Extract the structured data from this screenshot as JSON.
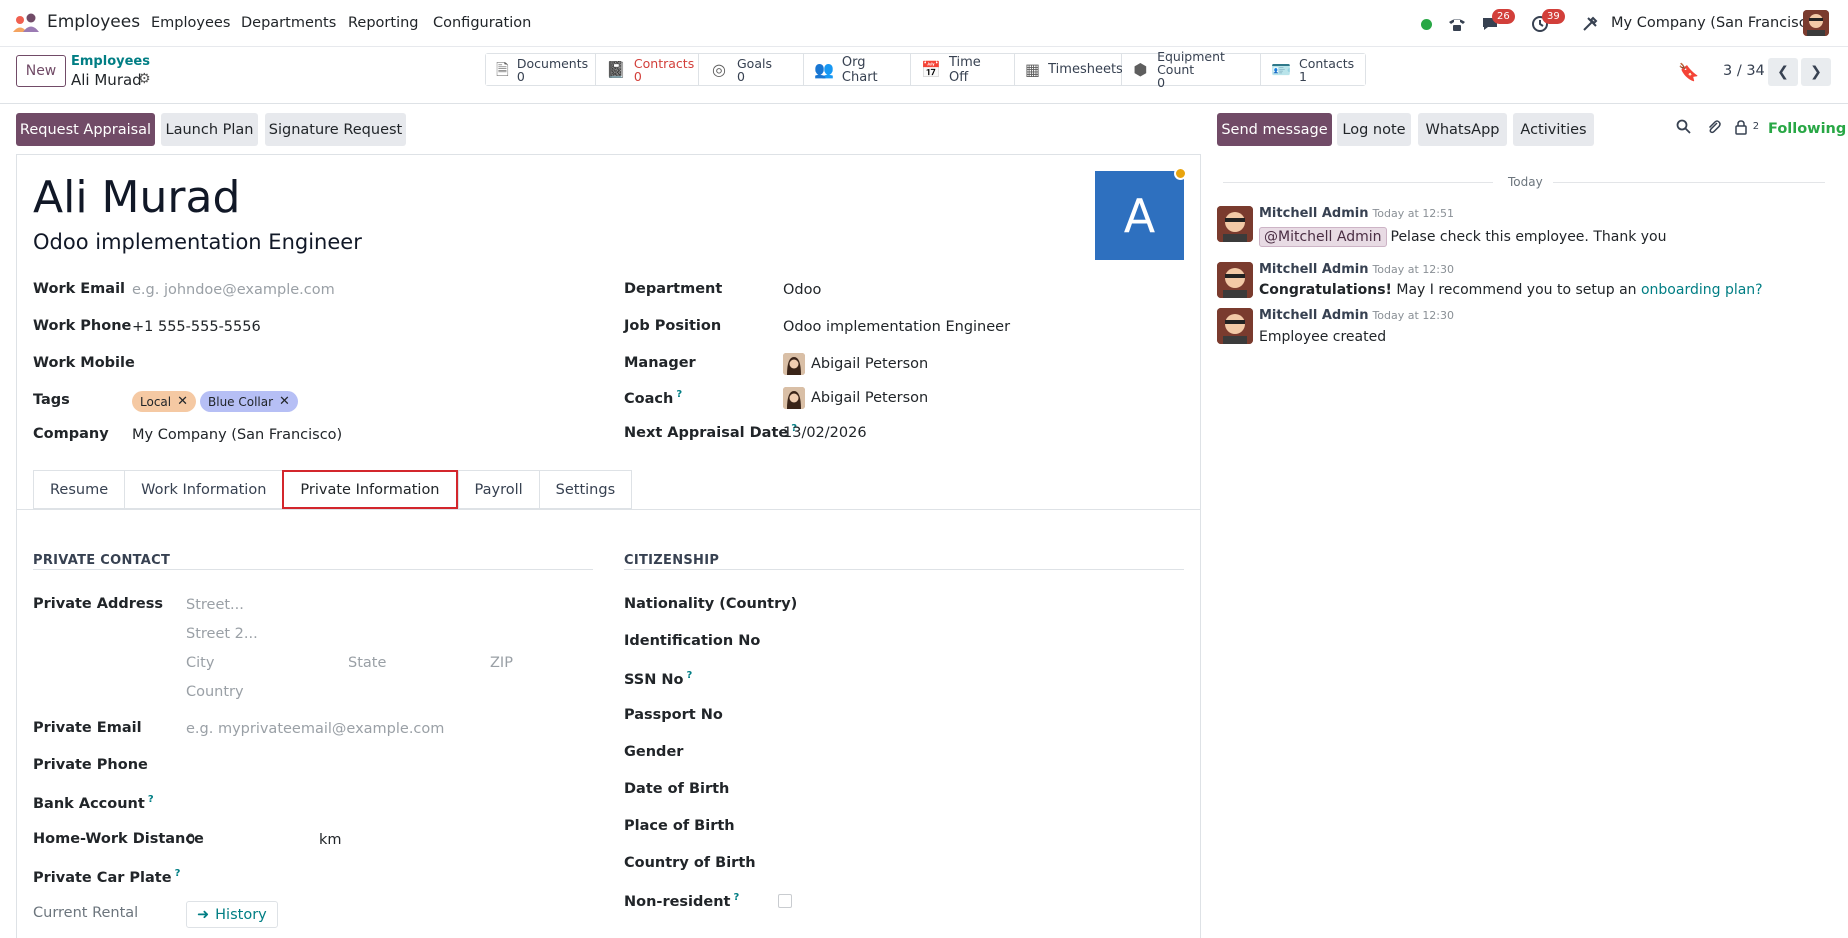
{
  "app": {
    "name": "Employees"
  },
  "menu": [
    "Employees",
    "Departments",
    "Reporting",
    "Configuration"
  ],
  "systray": {
    "chat_badge": "26",
    "activity_badge": "39",
    "company": "My Company (San Francisco)"
  },
  "control_panel": {
    "new_label": "New",
    "breadcrumb_parent": "Employees",
    "breadcrumb_current": "Ali Murad",
    "pager": "3 / 34"
  },
  "smart_buttons": [
    {
      "label": "Documents",
      "value": "0",
      "icon": "file-icon"
    },
    {
      "label": "Contracts",
      "value": "0",
      "icon": "book-icon"
    },
    {
      "label": "Goals",
      "value": "0",
      "icon": "target-icon"
    },
    {
      "label": "Org Chart",
      "icon": "users-icon"
    },
    {
      "label": "Time Off",
      "icon": "calendar-icon"
    },
    {
      "label": "Timesheets",
      "icon": "calendar-icon"
    },
    {
      "label": "Equipment Count",
      "value": "0",
      "icon": "cubes-icon"
    },
    {
      "label": "Contacts",
      "value": "1",
      "icon": "contact-card-icon"
    }
  ],
  "actions": [
    "Request Appraisal",
    "Launch Plan",
    "Signature Request"
  ],
  "employee": {
    "name": "Ali Murad",
    "job_title": "Odoo implementation Engineer",
    "avatar_letter": "A"
  },
  "fields_left": {
    "work_email_label": "Work Email",
    "work_email_placeholder": "e.g. johndoe@example.com",
    "work_phone_label": "Work Phone",
    "work_phone": "+1 555-555-5556",
    "work_mobile_label": "Work Mobile",
    "tags_label": "Tags",
    "tags": [
      {
        "name": "Local",
        "color": "#f5c9a3"
      },
      {
        "name": "Blue Collar",
        "color": "#b6bff5"
      }
    ],
    "company_label": "Company",
    "company": "My Company (San Francisco)"
  },
  "fields_right": {
    "department_label": "Department",
    "department": "Odoo",
    "job_position_label": "Job Position",
    "job_position": "Odoo implementation Engineer",
    "manager_label": "Manager",
    "manager": "Abigail Peterson",
    "coach_label": "Coach",
    "coach": "Abigail Peterson",
    "next_appraisal_label": "Next Appraisal Date",
    "next_appraisal": "13/02/2026"
  },
  "tabs": [
    "Resume",
    "Work Information",
    "Private Information",
    "Payroll",
    "Settings"
  ],
  "active_tab": "Private Information",
  "private_contact": {
    "title": "PRIVATE CONTACT",
    "address_label": "Private Address",
    "street_ph": "Street...",
    "street2_ph": "Street 2...",
    "city_ph": "City",
    "state_ph": "State",
    "zip_ph": "ZIP",
    "country_ph": "Country",
    "email_label": "Private Email",
    "email_ph": "e.g. myprivateemail@example.com",
    "phone_label": "Private Phone",
    "bank_label": "Bank Account",
    "distance_label": "Home-Work Distance",
    "distance_value": "0",
    "distance_unit": "km",
    "car_plate_label": "Private Car Plate",
    "rental_label": "Current Rental",
    "history_label": "History"
  },
  "citizenship": {
    "title": "CITIZENSHIP",
    "nationality_label": "Nationality (Country)",
    "identification_label": "Identification No",
    "ssn_label": "SSN No",
    "passport_label": "Passport No",
    "gender_label": "Gender",
    "dob_label": "Date of Birth",
    "pob_label": "Place of Birth",
    "cob_label": "Country of Birth",
    "non_resident_label": "Non-resident"
  },
  "chatter": {
    "send_label": "Send message",
    "log_label": "Log note",
    "whatsapp_label": "WhatsApp",
    "activities_label": "Activities",
    "followers_count": "2",
    "following_label": "Following",
    "today_label": "Today",
    "messages": [
      {
        "author": "Mitchell Admin",
        "time": "Today at 12:51",
        "mention": "@Mitchell Admin",
        "text": "Pelase check this employee. Thank you"
      },
      {
        "author": "Mitchell Admin",
        "time": "Today at 12:30",
        "bold": "Congratulations!",
        "text": " May I recommend you to setup an ",
        "link": "onboarding plan?"
      },
      {
        "author": "Mitchell Admin",
        "time": "Today at 12:30",
        "text": "Employee created"
      }
    ]
  }
}
